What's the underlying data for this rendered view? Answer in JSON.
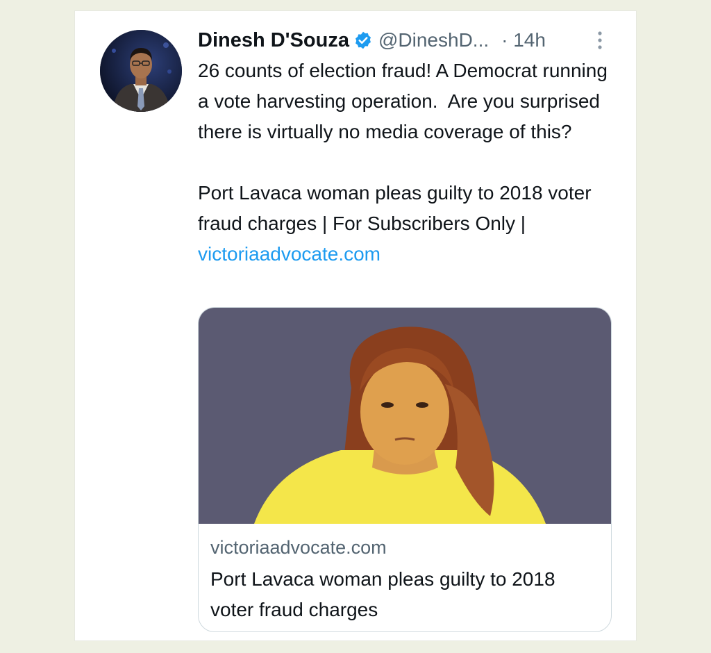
{
  "tweet": {
    "author_name": "Dinesh D'Souza",
    "handle": "@DineshD...",
    "time": "· 14h",
    "text_main": "26 counts of election fraud! A Democrat running a vote harvesting operation.  Are you surprised there is virtually no media coverage of this?",
    "text_headline": "Port Lavaca woman pleas guilty to 2018 voter fraud charges | For Subscribers Only | ",
    "text_link": "victoriaadvocate.com",
    "verified_icon": "verified-badge-icon",
    "more_icon": "more-options-icon"
  },
  "link_card": {
    "domain": "victoriaadvocate.com",
    "title": "Port Lavaca woman pleas guilty to 2018 voter fraud charges"
  },
  "colors": {
    "page_background": "#eef0e3",
    "link": "#1d9bf0",
    "secondary_text": "#536471",
    "verified": "#1d9bf0"
  }
}
